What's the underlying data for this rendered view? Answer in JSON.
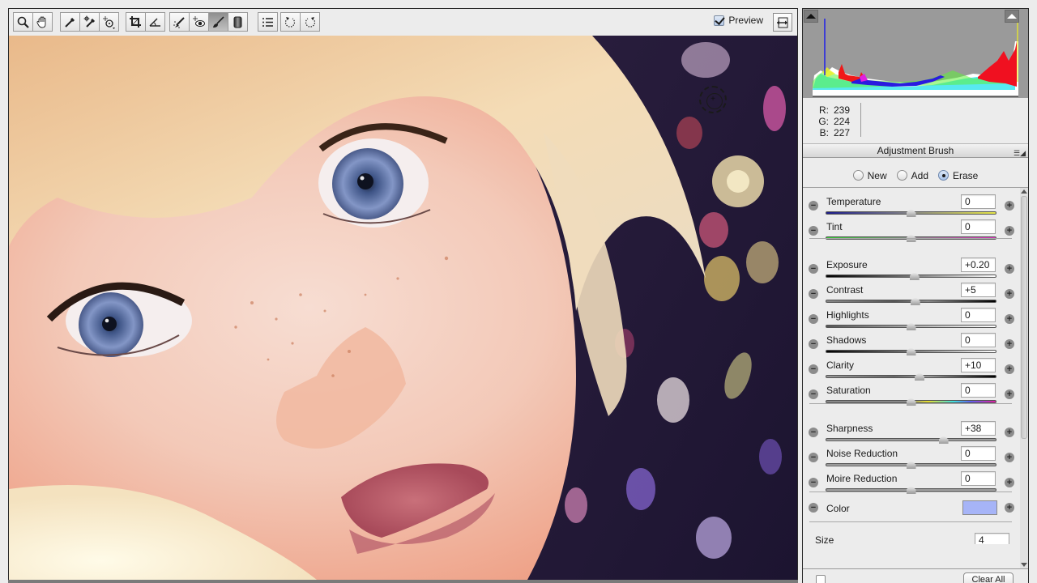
{
  "toolbar": {
    "tools": [
      {
        "name": "zoom-tool",
        "icon": "magnifier-icon",
        "active": false
      },
      {
        "name": "hand-tool",
        "icon": "hand-icon",
        "active": false
      },
      {
        "name": "white-balance-tool",
        "icon": "eyedropper-icon",
        "active": false
      },
      {
        "name": "color-sampler-tool",
        "icon": "color-sampler-icon",
        "active": false
      },
      {
        "name": "targeted-adjustment-tool",
        "icon": "target-adjust-icon",
        "active": false
      },
      {
        "name": "crop-tool",
        "icon": "crop-icon",
        "active": false
      },
      {
        "name": "straighten-tool",
        "icon": "straighten-icon",
        "active": false
      },
      {
        "name": "spot-removal-tool",
        "icon": "spot-removal-icon",
        "active": false
      },
      {
        "name": "red-eye-tool",
        "icon": "red-eye-icon",
        "active": false
      },
      {
        "name": "adjustment-brush-tool",
        "icon": "brush-icon",
        "active": true
      },
      {
        "name": "graduated-filter-tool",
        "icon": "graduated-filter-icon",
        "active": false
      },
      {
        "name": "preferences-tool",
        "icon": "list-icon",
        "active": false
      },
      {
        "name": "rotate-left-tool",
        "icon": "rotate-ccw-icon",
        "active": false
      },
      {
        "name": "rotate-right-tool",
        "icon": "rotate-cw-icon",
        "active": false
      }
    ],
    "preview_label": "Preview",
    "preview_checked": true
  },
  "readout": {
    "r_label": "R:",
    "r_value": "239",
    "g_label": "G:",
    "g_value": "224",
    "b_label": "B:",
    "b_value": "227"
  },
  "panel": {
    "title": "Adjustment Brush",
    "modes": [
      {
        "label": "New",
        "checked": false
      },
      {
        "label": "Add",
        "checked": false
      },
      {
        "label": "Erase",
        "checked": true
      }
    ],
    "sliders": [
      {
        "label": "Temperature",
        "value": "0",
        "position": 0.5,
        "track": "temperature"
      },
      {
        "label": "Tint",
        "value": "0",
        "position": 0.5,
        "track": "tint"
      },
      {
        "label": "Exposure",
        "value": "+0.20",
        "position": 0.52,
        "track": "exposure"
      },
      {
        "label": "Contrast",
        "value": "+5",
        "position": 0.525,
        "track": "contrast"
      },
      {
        "label": "Highlights",
        "value": "0",
        "position": 0.5,
        "track": "highlights"
      },
      {
        "label": "Shadows",
        "value": "0",
        "position": 0.5,
        "track": "shadows"
      },
      {
        "label": "Clarity",
        "value": "+10",
        "position": 0.55,
        "track": "clarity"
      },
      {
        "label": "Saturation",
        "value": "0",
        "position": 0.5,
        "track": "saturation"
      },
      {
        "label": "Sharpness",
        "value": "+38",
        "position": 0.69,
        "track": "plain"
      },
      {
        "label": "Noise Reduction",
        "value": "0",
        "position": 0.5,
        "track": "plain"
      },
      {
        "label": "Moire Reduction",
        "value": "0",
        "position": 0.5,
        "track": "plain"
      }
    ],
    "color_label": "Color",
    "color_swatch": "#a6b4f7",
    "size_label": "Size",
    "size_value": "4",
    "size_position": 0.02,
    "clear_all_label": "Clear All"
  },
  "colors": {
    "accent_checkbox": "#b5c9e6",
    "panel_bg": "#ececec",
    "histogram_bg": "#9a9a9a"
  }
}
